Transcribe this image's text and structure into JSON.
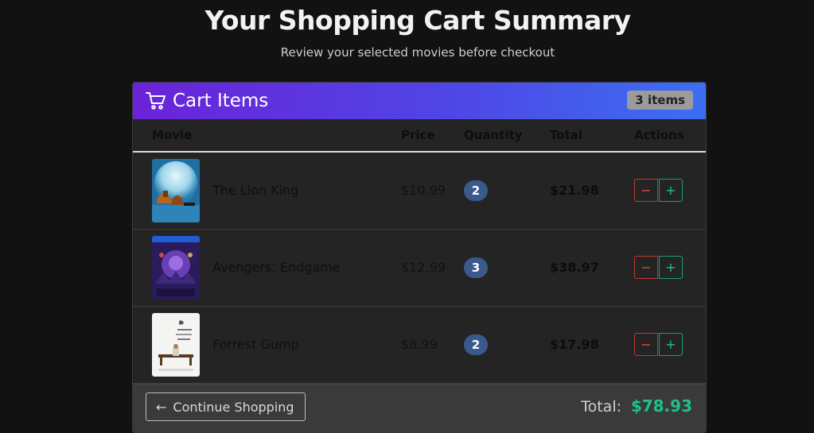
{
  "page": {
    "title": "Your Shopping Cart Summary",
    "subtitle": "Review your selected movies before checkout"
  },
  "cart": {
    "header_title": "Cart Items",
    "items_badge": "3 items",
    "columns": {
      "movie": "Movie",
      "price": "Price",
      "quantity": "Quantity",
      "total": "Total",
      "actions": "Actions"
    },
    "items": [
      {
        "name": "The Lion King",
        "price": "$10.99",
        "quantity": "2",
        "total": "$21.98"
      },
      {
        "name": "Avengers: Endgame",
        "price": "$12.99",
        "quantity": "3",
        "total": "$38.97"
      },
      {
        "name": "Forrest Gump",
        "price": "$8.99",
        "quantity": "2",
        "total": "$17.98"
      }
    ],
    "footer": {
      "continue_label": "Continue Shopping",
      "total_label": "Total:",
      "total_value": "$78.93"
    }
  },
  "colors": {
    "header_gradient_start": "#6b22d8",
    "header_gradient_end": "#3b6ff2",
    "total_value": "#1fc08e",
    "minus_button": "#e74c3c",
    "plus_button": "#22c08f",
    "quantity_badge": "#3a5a8c"
  },
  "icons": {
    "cart": "shopping-cart-icon",
    "minus": "minus-icon",
    "plus": "plus-icon",
    "back": "arrow-left-icon"
  }
}
